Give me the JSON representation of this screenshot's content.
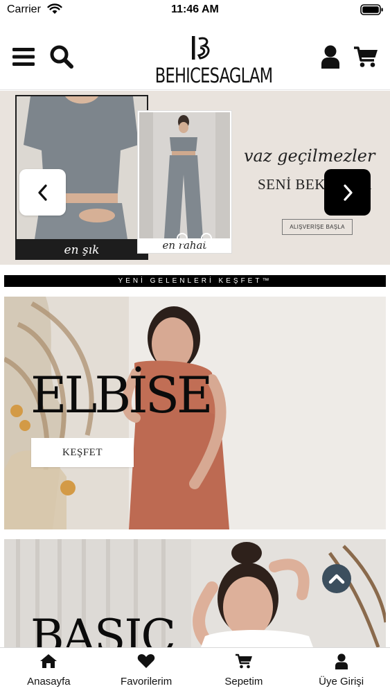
{
  "status_bar": {
    "carrier": "Carrier",
    "time": "11:46 AM"
  },
  "header": {
    "logo_text": "BEHICESAGLAM",
    "icons": [
      "menu-icon",
      "search-icon",
      "user-icon",
      "cart-icon"
    ]
  },
  "slider": {
    "caption_left": "en şık",
    "caption_right": "en rahat",
    "headline": "vaz geçilmezler",
    "subline": "SENİ BEKLİYOR",
    "cta": "ALIŞVERİŞE BAŞLA",
    "prev_icon": "chevron-left-icon",
    "next_icon": "chevron-right-icon"
  },
  "new_arrivals": {
    "label": "YENİ GELENLERİ KEŞFET™"
  },
  "categories": [
    {
      "title": "ELBİSE",
      "button": "KEŞFET"
    },
    {
      "title": "BASIC"
    }
  ],
  "tabs": [
    {
      "label": "Anasayfa",
      "icon": "home-icon"
    },
    {
      "label": "Favorilerim",
      "icon": "heart-icon"
    },
    {
      "label": "Sepetim",
      "icon": "cart-icon"
    },
    {
      "label": "Üye Girişi",
      "icon": "user-icon"
    }
  ],
  "colors": {
    "scroll_top": "#3c4f5e",
    "slider_bg": "#e9e3dd",
    "black": "#000000"
  }
}
